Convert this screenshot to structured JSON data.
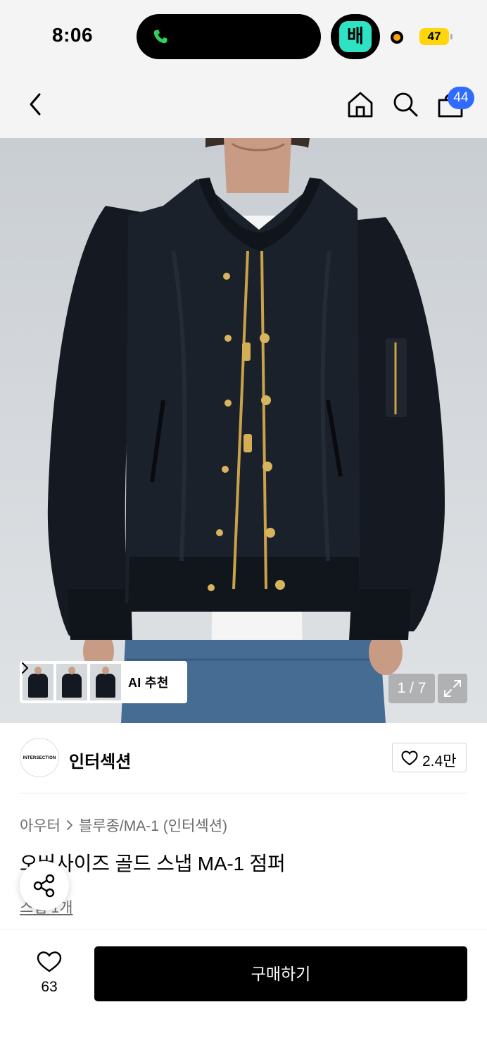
{
  "status": {
    "time": "8:06",
    "app_badge": "배",
    "battery": "47"
  },
  "nav": {
    "cart_count": "44"
  },
  "gallery": {
    "ai_label": "AI 추천",
    "counter": "1 / 7"
  },
  "brand": {
    "logo_text": "INTERSECTION",
    "name": "인터섹션",
    "likes": "2.4만"
  },
  "product": {
    "breadcrumb": [
      "아우터",
      "블루종/MA-1 (인터섹션)"
    ],
    "title": "오버사이즈 골드 스냅 MA-1 점퍼",
    "snap_link": "스냅 1개"
  },
  "bottom": {
    "wish_count": "63",
    "buy_label": "구매하기"
  },
  "colors": {
    "accent_badge": "#2f6bff",
    "buy_button": "#000000",
    "app_teal": "#2de3c3",
    "battery": "#ffd60a"
  },
  "icons": [
    "phone-icon",
    "back-icon",
    "home-icon",
    "search-icon",
    "bag-icon",
    "chevron-right-icon",
    "expand-icon",
    "heart-icon",
    "share-icon"
  ]
}
